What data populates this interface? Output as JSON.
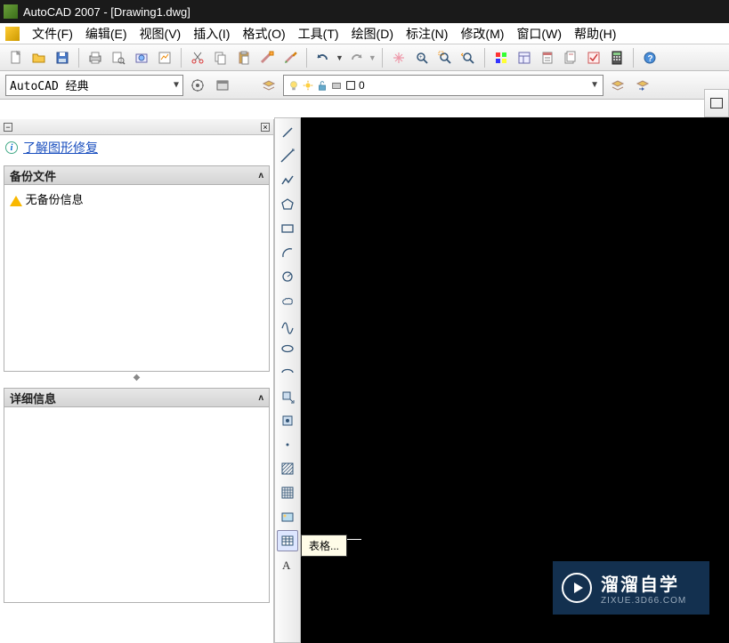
{
  "title": "AutoCAD 2007 - [Drawing1.dwg]",
  "menu": {
    "file": "文件(F)",
    "edit": "编辑(E)",
    "view": "视图(V)",
    "insert": "插入(I)",
    "format": "格式(O)",
    "tools": "工具(T)",
    "draw": "绘图(D)",
    "dimension": "标注(N)",
    "modify": "修改(M)",
    "window": "窗口(W)",
    "help": "帮助(H)"
  },
  "workspace": {
    "selected": "AutoCAD 经典"
  },
  "layer": {
    "current": "0"
  },
  "leftpanel": {
    "recovery_link": "了解图形修复",
    "backup_header": "备份文件",
    "backup_empty": "无备份信息",
    "detail_header": "详细信息"
  },
  "tooltip": {
    "table": "表格..."
  },
  "watermark": {
    "main": "溜溜自学",
    "sub": "ZIXUE.3D66.COM"
  },
  "icons": {
    "std": [
      "new",
      "open",
      "save",
      "print",
      "preview",
      "publish",
      "cut",
      "cut2",
      "copy",
      "paste",
      "match",
      "brush",
      "undo",
      "redo",
      "pan",
      "zoom-rt",
      "zoom-win",
      "zoom-prev",
      "properties",
      "designcenter",
      "toolpalettes",
      "sheetset",
      "markup",
      "calc",
      "help"
    ],
    "draw": [
      "line",
      "xline",
      "polyline",
      "polygon",
      "rectangle",
      "arc",
      "circle",
      "revcloud",
      "spline",
      "ellipse",
      "ellipse-arc",
      "block-insert",
      "block-make",
      "point",
      "hatch",
      "gradient",
      "region",
      "table",
      "text"
    ]
  }
}
